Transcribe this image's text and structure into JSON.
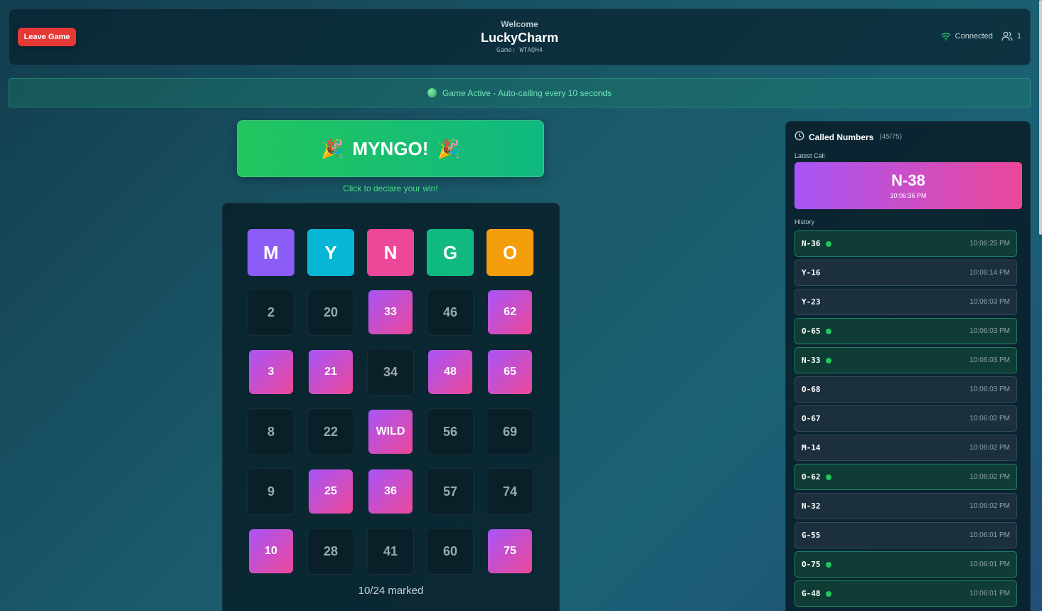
{
  "header": {
    "leave_label": "Leave Game",
    "welcome": "Welcome",
    "username": "LuckyCharm",
    "game_code": "Game: WTAQH4",
    "connection_status": "Connected",
    "player_count": "1"
  },
  "status_banner": {
    "text": "Game Active - Auto-calling every 10 seconds"
  },
  "myngo": {
    "label": "MYNGO!",
    "left_emoji": "🎉",
    "right_emoji": "🎉",
    "hint": "Click to declare your win!"
  },
  "card": {
    "headers": [
      {
        "letter": "M",
        "color": "#8b5cf6"
      },
      {
        "letter": "Y",
        "color": "#06b6d4"
      },
      {
        "letter": "N",
        "color": "#ec4899"
      },
      {
        "letter": "G",
        "color": "#10b981"
      },
      {
        "letter": "O",
        "color": "#f59e0b"
      }
    ],
    "rows": [
      [
        {
          "v": "2",
          "m": false
        },
        {
          "v": "20",
          "m": false
        },
        {
          "v": "33",
          "m": true
        },
        {
          "v": "46",
          "m": false
        },
        {
          "v": "62",
          "m": true
        }
      ],
      [
        {
          "v": "3",
          "m": true
        },
        {
          "v": "21",
          "m": true
        },
        {
          "v": "34",
          "m": false
        },
        {
          "v": "48",
          "m": true
        },
        {
          "v": "65",
          "m": true
        }
      ],
      [
        {
          "v": "8",
          "m": false
        },
        {
          "v": "22",
          "m": false
        },
        {
          "v": "WILD",
          "m": true
        },
        {
          "v": "56",
          "m": false
        },
        {
          "v": "69",
          "m": false
        }
      ],
      [
        {
          "v": "9",
          "m": false
        },
        {
          "v": "25",
          "m": true
        },
        {
          "v": "36",
          "m": true
        },
        {
          "v": "57",
          "m": false
        },
        {
          "v": "74",
          "m": false
        }
      ],
      [
        {
          "v": "10",
          "m": true
        },
        {
          "v": "28",
          "m": false
        },
        {
          "v": "41",
          "m": false
        },
        {
          "v": "60",
          "m": false
        },
        {
          "v": "75",
          "m": true
        }
      ]
    ],
    "marked_text": "10/24 marked"
  },
  "called": {
    "title": "Called Numbers",
    "count": "(45/75)",
    "latest_label": "Latest Call",
    "latest_number": "N-38",
    "latest_time": "10:06:36 PM",
    "history_label": "History",
    "history": [
      {
        "num": "N-36",
        "time": "10:06:25 PM",
        "marked": true
      },
      {
        "num": "Y-16",
        "time": "10:06:14 PM",
        "marked": false
      },
      {
        "num": "Y-23",
        "time": "10:06:03 PM",
        "marked": false
      },
      {
        "num": "O-65",
        "time": "10:06:03 PM",
        "marked": true
      },
      {
        "num": "N-33",
        "time": "10:06:03 PM",
        "marked": true
      },
      {
        "num": "O-68",
        "time": "10:06:03 PM",
        "marked": false
      },
      {
        "num": "O-67",
        "time": "10:06:02 PM",
        "marked": false
      },
      {
        "num": "M-14",
        "time": "10:06:02 PM",
        "marked": false
      },
      {
        "num": "O-62",
        "time": "10:06:02 PM",
        "marked": true
      },
      {
        "num": "N-32",
        "time": "10:06:02 PM",
        "marked": false
      },
      {
        "num": "G-55",
        "time": "10:06:01 PM",
        "marked": false
      },
      {
        "num": "O-75",
        "time": "10:06:01 PM",
        "marked": true
      },
      {
        "num": "G-48",
        "time": "10:06:01 PM",
        "marked": true
      }
    ]
  }
}
